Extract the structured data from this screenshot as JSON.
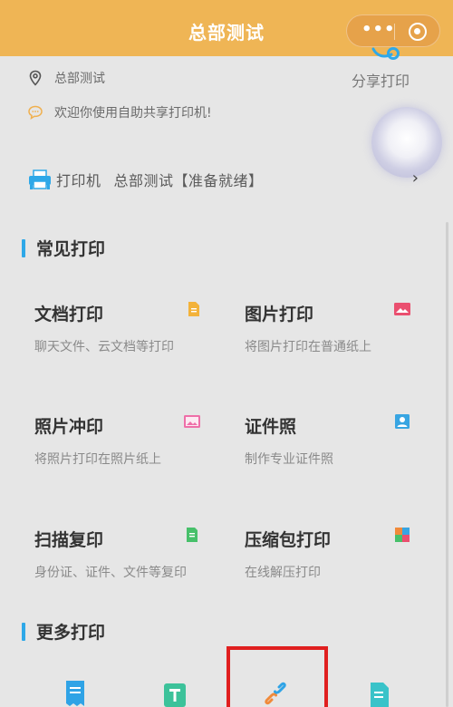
{
  "topbar": {
    "title": "总部测试"
  },
  "info": {
    "location": "总部测试",
    "welcome": "欢迎你使用自助共享打印机!",
    "share_label": "分享打印"
  },
  "printer": {
    "label": "打印机",
    "status": "总部测试【准备就绪】",
    "chevron": "›"
  },
  "sections": {
    "common_title": "常见打印",
    "more_title": "更多打印"
  },
  "tiles": [
    {
      "title": "文档打印",
      "subtitle": "聊天文件、云文档等打印",
      "icon": "document-icon",
      "color": "#f3b23a"
    },
    {
      "title": "图片打印",
      "subtitle": "将图片打印在普通纸上",
      "icon": "picture-icon",
      "color": "#ea4f6f"
    },
    {
      "title": "照片冲印",
      "subtitle": "将照片打印在照片纸上",
      "icon": "photo-icon",
      "color": "#ee6fa8"
    },
    {
      "title": "证件照",
      "subtitle": "制作专业证件照",
      "icon": "id-photo-icon",
      "color": "#38a5e2"
    },
    {
      "title": "扫描复印",
      "subtitle": "身份证、证件、文件等复印",
      "icon": "scan-icon",
      "color": "#47c06a"
    },
    {
      "title": "压缩包打印",
      "subtitle": "在线解压打印",
      "icon": "archive-icon",
      "color": "#f08a3a"
    }
  ],
  "more_icons": [
    {
      "icon": "receipt-icon",
      "color": "#2fa3e6"
    },
    {
      "icon": "text-icon",
      "color": "#3cc29a"
    },
    {
      "icon": "link-icon",
      "color": "#f08a3a"
    },
    {
      "icon": "file-edit-icon",
      "color": "#39c3c9"
    }
  ]
}
